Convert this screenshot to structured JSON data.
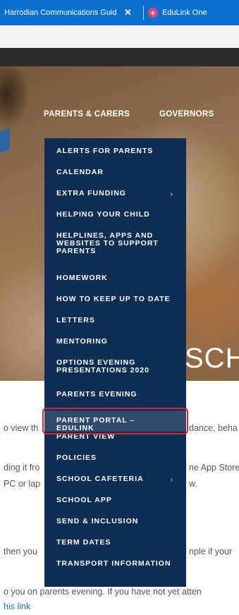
{
  "browser": {
    "tabs": [
      {
        "title": "Harrodian Communications Guid",
        "close": "✕",
        "active": true
      },
      {
        "title": "EduLink One",
        "favicon": "e",
        "active": false
      }
    ]
  },
  "site_nav": {
    "parents_carers": "PARENTS & CARERS",
    "governors": "GOVERNORS"
  },
  "hero": {
    "heading_fragment": "SCHO"
  },
  "dropdown": {
    "items": [
      {
        "label": "ALERTS FOR PARENTS"
      },
      {
        "label": "CALENDAR"
      },
      {
        "label": "EXTRA FUNDING",
        "submenu": true
      },
      {
        "label": "HELPING YOUR CHILD"
      },
      {
        "label": "HELPLINES, APPS AND WEBSITES TO SUPPORT PARENTS"
      },
      {
        "label": "HOMEWORK"
      },
      {
        "label": "HOW TO KEEP UP TO DATE"
      },
      {
        "label": "LETTERS"
      },
      {
        "label": "MENTORING"
      },
      {
        "label": "OPTIONS EVENING PRESENTATIONS 2020"
      },
      {
        "label": "PARENTS EVENING"
      },
      {
        "label": "PARENT PORTAL – EDULINK",
        "highlighted": true
      },
      {
        "label": "PARENT VIEW"
      },
      {
        "label": "POLICIES"
      },
      {
        "label": "SCHOOL CAFETERIA",
        "submenu": true
      },
      {
        "label": "SCHOOL APP"
      },
      {
        "label": "SEND & INCLUSION"
      },
      {
        "label": "TERM DATES"
      },
      {
        "label": "TRANSPORT INFORMATION"
      }
    ],
    "submenu_indicator": "›"
  },
  "body_text": {
    "left1": "o view th",
    "right1": "dance, beha",
    "left2": "ding it fro",
    "right2": "ne App Store",
    "left3": "PC or lap",
    "right3": "w.",
    "left4": "then you",
    "right4": "nple if your",
    "line5": "o you on parents evening. If you have not yet atten",
    "link": "his link"
  },
  "colors": {
    "tab_bar": "#0a6fcf",
    "menu_bg": "#0f2d55",
    "menu_active_bg": "#2f4a6d",
    "highlight_border": "#e0242b",
    "link": "#1b73c9"
  }
}
